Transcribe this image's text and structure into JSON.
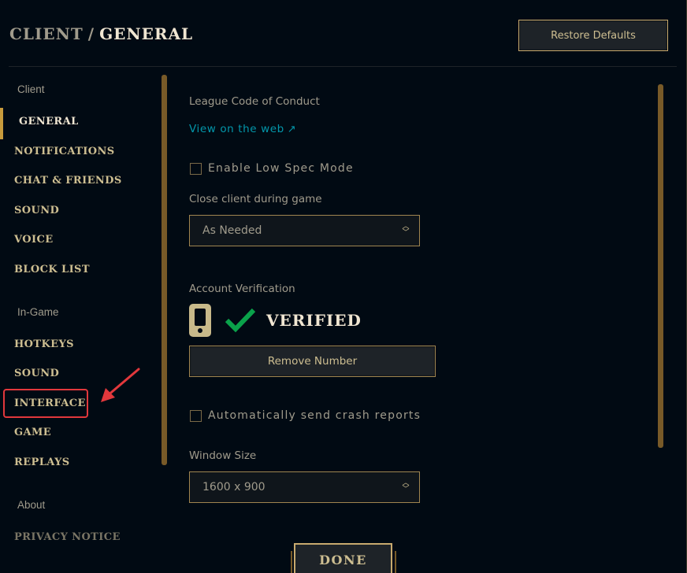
{
  "header": {
    "breadcrumb_parent": "CLIENT",
    "breadcrumb_separator": "/",
    "breadcrumb_current": "GENERAL",
    "restore_defaults_label": "Restore Defaults"
  },
  "sidebar": {
    "sections": [
      {
        "label": "Client",
        "items": [
          {
            "label": "GENERAL",
            "active": true
          },
          {
            "label": "NOTIFICATIONS"
          },
          {
            "label": "CHAT & FRIENDS"
          },
          {
            "label": "SOUND"
          },
          {
            "label": "VOICE"
          },
          {
            "label": "BLOCK LIST"
          }
        ]
      },
      {
        "label": "In-Game",
        "items": [
          {
            "label": "HOTKEYS"
          },
          {
            "label": "SOUND"
          },
          {
            "label": "INTERFACE",
            "highlighted": true
          },
          {
            "label": "GAME"
          },
          {
            "label": "REPLAYS"
          }
        ]
      },
      {
        "label": "About",
        "items": [
          {
            "label": "PRIVACY NOTICE"
          }
        ]
      }
    ]
  },
  "main": {
    "code_of_conduct_label": "League Code of Conduct",
    "view_on_web_link": "View on the web",
    "view_on_web_icon": "↗",
    "low_spec_mode": {
      "label": "Enable Low Spec Mode",
      "checked": false
    },
    "close_client": {
      "label": "Close client during game",
      "value": "As Needed"
    },
    "account_verification": {
      "label": "Account Verification",
      "status": "VERIFIED",
      "remove_button_label": "Remove Number"
    },
    "crash_reports": {
      "label": "Automatically send crash reports",
      "checked": false
    },
    "window_size": {
      "label": "Window Size",
      "value": "1600 x 900"
    }
  },
  "footer": {
    "done_label": "DONE"
  },
  "colors": {
    "background": "#010a13",
    "gold": "#c8aa6e",
    "gold_text": "#cdbe91",
    "link": "#0397ab",
    "verified_check": "#0aa24a",
    "annotation_red": "#e2383c"
  }
}
